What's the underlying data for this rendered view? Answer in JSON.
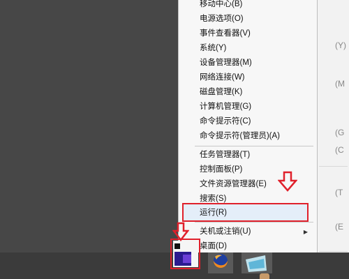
{
  "power_menu": {
    "items": [
      {
        "label": "移动中心(B)"
      },
      {
        "label": "电源选项(O)"
      },
      {
        "label": "事件查看器(V)"
      },
      {
        "label": "系统(Y)"
      },
      {
        "label": "设备管理器(M)"
      },
      {
        "label": "网络连接(W)"
      },
      {
        "label": "磁盘管理(K)"
      },
      {
        "label": "计算机管理(G)"
      },
      {
        "label": "命令提示符(C)"
      },
      {
        "label": "命令提示符(管理员)(A)"
      },
      {
        "label": "任务管理器(T)"
      },
      {
        "label": "控制面板(P)"
      },
      {
        "label": "文件资源管理器(E)"
      },
      {
        "label": "搜索(S)"
      },
      {
        "label": "运行(R)",
        "highlighted": true
      },
      {
        "label": "关机或注销(U)",
        "has_submenu": true
      },
      {
        "label": "桌面(D)"
      }
    ]
  },
  "background_text": [
    "(Y)",
    "(M",
    "(G",
    "(C",
    "(T",
    "(E"
  ],
  "colors": {
    "annotation_red": "#e0202b",
    "menu_bg": "#f7f7f7",
    "highlight_bg": "#e4eef9",
    "taskbar": "#3b3b3b"
  },
  "taskbar": {
    "icons": [
      "start-button-icon",
      "firefox-icon",
      "app-icon"
    ]
  }
}
